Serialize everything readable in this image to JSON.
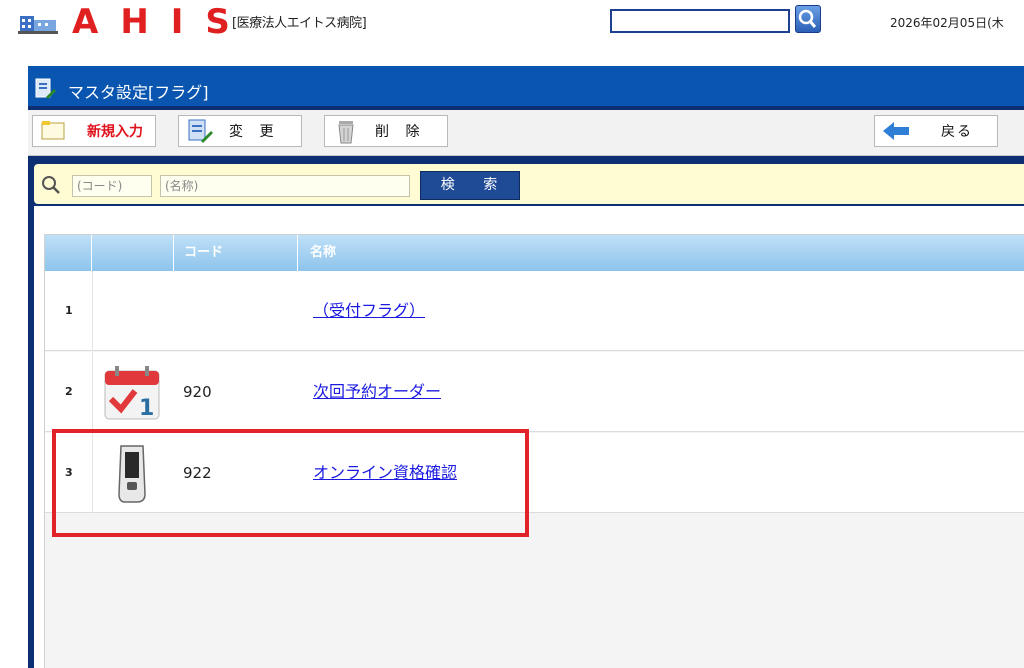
{
  "header": {
    "logo_text": "AHIS",
    "hospital_name": "[医療法人エイトス病院]",
    "search_value": "",
    "date_text": "2026年02月05日(木"
  },
  "panel": {
    "title": "マスタ設定[フラグ]"
  },
  "toolbar": {
    "new_label": "新規入力",
    "edit_label": "変 更",
    "delete_label": "削 除",
    "back_label": "戻る"
  },
  "search": {
    "code_placeholder": "(コード)",
    "name_placeholder": "(名称)",
    "button_label": "検 索"
  },
  "table": {
    "headers": [
      "",
      "",
      "コード",
      "名称"
    ],
    "rows": [
      {
        "num": "1",
        "icon": "",
        "code": "",
        "name": "（受付フラグ）"
      },
      {
        "num": "2",
        "icon": "calendar-check-icon",
        "code": "920",
        "name": "次回予約オーダー"
      },
      {
        "num": "3",
        "icon": "card-reader-icon",
        "code": "922",
        "name": "オンライン資格確認"
      }
    ]
  },
  "colors": {
    "brand_red": "#e02020",
    "title_blue": "#0a55b0",
    "panel_navy": "#0b2f72",
    "highlight_red": "#e12229",
    "link_blue": "#1a1ae0"
  }
}
